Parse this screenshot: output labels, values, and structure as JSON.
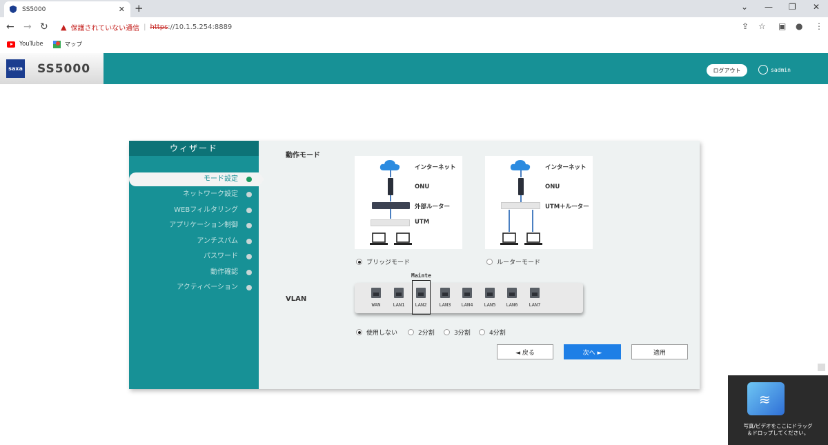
{
  "browser": {
    "tab_title": "SS5000",
    "warning_text": "保護されていない通信",
    "url_protocol": "https",
    "url_host": "://10.1.5.254:8889",
    "bookmarks": [
      "YouTube",
      "マップ"
    ]
  },
  "header": {
    "logo_text": "saxa",
    "model": "SS5000",
    "logout_label": "ログアウト",
    "username": "sadmin"
  },
  "sidebar": {
    "title": "ウィザード",
    "steps": [
      "モード設定",
      "ネットワーク設定",
      "WEBフィルタリング",
      "アプリケーション制御",
      "アンチスパム",
      "パスワード",
      "動作確認",
      "アクティベーション"
    ]
  },
  "mode": {
    "label": "動作モード",
    "bridge": {
      "internet": "インターネット",
      "onu": "ONU",
      "router": "外部ルーター",
      "utm": "UTM",
      "option": "ブリッジモード"
    },
    "router": {
      "internet": "インターネット",
      "onu": "ONU",
      "utm": "UTM＋ルーター",
      "option": "ルーターモード"
    },
    "selected": "bridge"
  },
  "vlan": {
    "label": "VLAN",
    "mainte": "Mainte",
    "ports": [
      "WAN",
      "LAN1",
      "LAN2",
      "LAN3",
      "LAN4",
      "LAN5",
      "LAN6",
      "LAN7"
    ],
    "options": [
      "使用しない",
      "2分割",
      "3分割",
      "4分割"
    ],
    "selected": "使用しない"
  },
  "buttons": {
    "back": "◄   戻る",
    "next": "次へ   ►",
    "apply": "適用"
  },
  "widget": {
    "line1": "写真/ビデオをここにドラッグ",
    "line2": "＆ドロップしてください。"
  }
}
